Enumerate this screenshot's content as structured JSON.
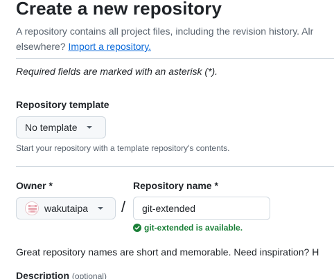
{
  "header": {
    "title": "Create a new repository",
    "intro_line1": "A repository contains all project files, including the revision history. Alr",
    "intro_line2_prefix": "elsewhere? ",
    "import_link": "Import a repository."
  },
  "form": {
    "required_note": "Required fields are marked with an asterisk (*).",
    "template": {
      "label": "Repository template",
      "selected": "No template",
      "hint": "Start your repository with a template repository's contents."
    },
    "owner": {
      "label": "Owner *",
      "selected": "wakutaipa"
    },
    "separator": "/",
    "repo_name": {
      "label": "Repository name *",
      "value": "git-extended",
      "availability": "git-extended is available."
    },
    "name_suggestion": "Great repository names are short and memorable. Need inspiration? H",
    "description": {
      "label": "Description",
      "optional": "(optional)"
    }
  },
  "colors": {
    "link": "#0969da",
    "success": "#1a7f37",
    "muted": "#59636e"
  },
  "icons": {
    "caret": "chevron-down-icon",
    "avatar": "identicon",
    "check": "check-circle-fill-icon"
  }
}
